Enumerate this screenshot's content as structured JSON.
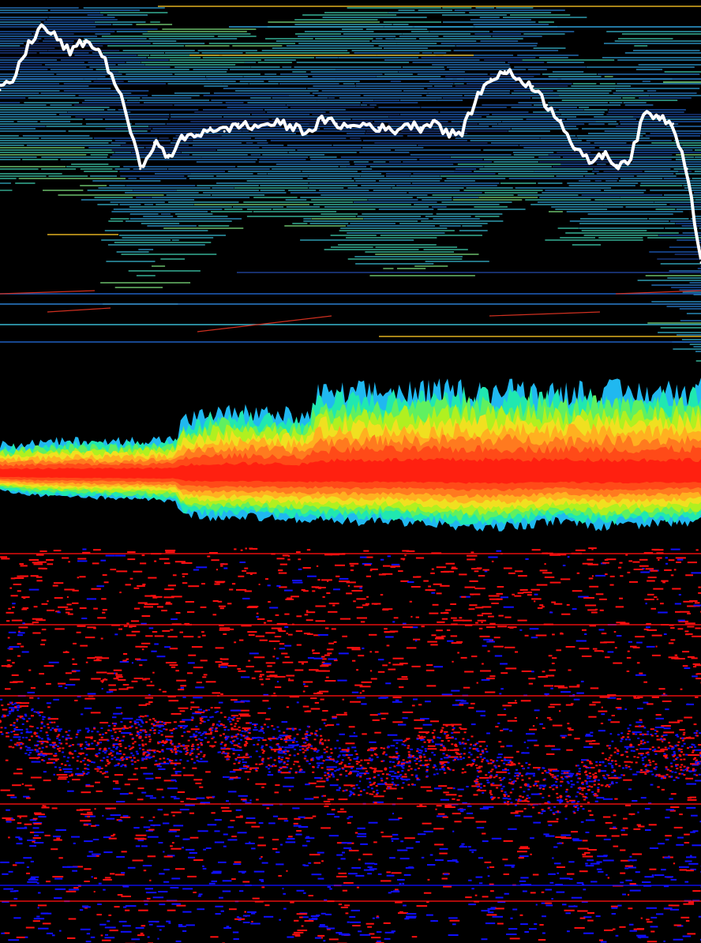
{
  "colors": {
    "background": "#000000",
    "price_line": "#ffffff",
    "order_level_palette": [
      "#1f3f8f",
      "#1f5fbf",
      "#2a7fd0",
      "#2fa0d8",
      "#38b8d0",
      "#3fd0b0",
      "#7fe07f",
      "#e0b020",
      "#d03020"
    ],
    "depth_palette": [
      "#ff2010",
      "#ff4a18",
      "#ff7a1f",
      "#ffb020",
      "#f0e020",
      "#b0f020",
      "#60f060",
      "#20e8b0",
      "#20b8f0"
    ],
    "buy_trade": "#1010ff",
    "sell_trade": "#ff1010"
  },
  "chart_data": [
    {
      "id": "order-book-heatmap",
      "type": "heatmap",
      "title": "",
      "xlabel": "",
      "ylabel": "",
      "grid": false,
      "legend": "none",
      "price_series": {
        "x": [
          0,
          2,
          4,
          6,
          8,
          10,
          12,
          14,
          16,
          18,
          20,
          22,
          24,
          26,
          28,
          30,
          32,
          34,
          36,
          38,
          40,
          42,
          44,
          46,
          48,
          50,
          52,
          54,
          56,
          58,
          60,
          62,
          64,
          66,
          68,
          70,
          72,
          74,
          76,
          78,
          80,
          82,
          84,
          86,
          88,
          90,
          92,
          94,
          96,
          98,
          100
        ],
        "y": [
          0.76,
          0.79,
          0.88,
          0.93,
          0.9,
          0.86,
          0.89,
          0.87,
          0.8,
          0.7,
          0.55,
          0.62,
          0.58,
          0.63,
          0.64,
          0.66,
          0.65,
          0.67,
          0.66,
          0.67,
          0.67,
          0.66,
          0.65,
          0.68,
          0.67,
          0.66,
          0.67,
          0.66,
          0.65,
          0.67,
          0.66,
          0.68,
          0.64,
          0.65,
          0.74,
          0.79,
          0.81,
          0.79,
          0.77,
          0.72,
          0.68,
          0.6,
          0.57,
          0.59,
          0.56,
          0.58,
          0.7,
          0.69,
          0.67,
          0.55,
          0.3
        ]
      }
    },
    {
      "id": "depth-distribution",
      "type": "area",
      "title": "",
      "xlabel": "",
      "ylabel": "",
      "grid": false,
      "legend": "none",
      "x": [
        0,
        5,
        10,
        15,
        20,
        25,
        26,
        30,
        35,
        40,
        44,
        45,
        50,
        55,
        60,
        65,
        70,
        75,
        80,
        85,
        90,
        95,
        100
      ],
      "ask_extent": [
        0.3,
        0.32,
        0.34,
        0.33,
        0.35,
        0.36,
        0.55,
        0.62,
        0.64,
        0.62,
        0.58,
        0.82,
        0.84,
        0.86,
        0.85,
        0.87,
        0.86,
        0.88,
        0.86,
        0.87,
        0.85,
        0.86,
        0.88
      ],
      "bid_extent": [
        0.22,
        0.28,
        0.3,
        0.32,
        0.34,
        0.36,
        0.52,
        0.58,
        0.56,
        0.6,
        0.62,
        0.6,
        0.64,
        0.62,
        0.66,
        0.7,
        0.72,
        0.68,
        0.62,
        0.7,
        0.68,
        0.66,
        0.64
      ]
    },
    {
      "id": "trade-scatter",
      "type": "scatter",
      "title": "",
      "xlabel": "",
      "ylabel": "",
      "grid": false,
      "legend": "none",
      "series": [
        {
          "x": [
            0,
            5,
            10,
            15,
            20,
            25,
            30,
            35,
            40,
            45,
            50,
            55,
            60,
            65,
            70,
            75,
            80,
            85,
            90,
            95,
            100
          ],
          "y": [
            0.56,
            0.53,
            0.48,
            0.49,
            0.52,
            0.49,
            0.54,
            0.5,
            0.49,
            0.49,
            0.43,
            0.44,
            0.47,
            0.5,
            0.42,
            0.4,
            0.37,
            0.42,
            0.5,
            0.47,
            0.48
          ]
        }
      ]
    }
  ]
}
